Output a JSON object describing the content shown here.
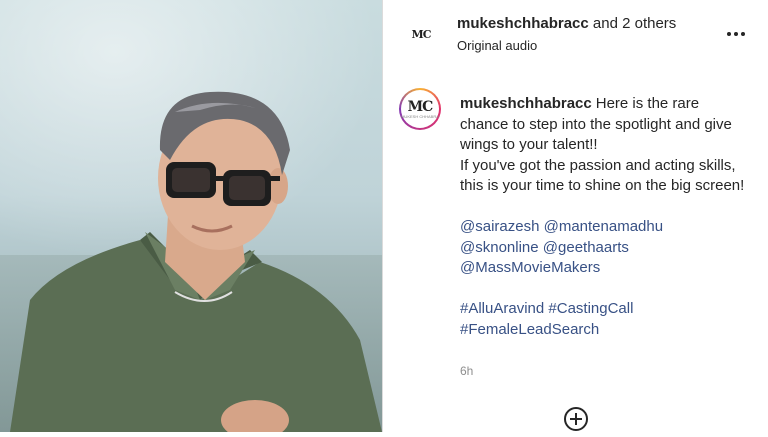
{
  "video": {
    "description_colors": {
      "sky": "#c9dcdf",
      "shirt": "#5b6e54"
    }
  },
  "header": {
    "avatar_text": "MC",
    "username": "mukeshchhabracc",
    "collab_text": "and 2 others",
    "audio_label": "Original audio"
  },
  "post": {
    "avatar_text": "MC",
    "avatar_subtext": "MUKESH CHHABRA",
    "username": "mukeshchhabracc",
    "caption_line1": "Here is the rare chance to step into the spotlight and give wings to your talent!!",
    "caption_line2": "If you've got the passion and acting skills, this is your time to shine on the big screen!",
    "mentions": [
      "@sairazesh",
      "@mantenamadhu",
      "@sknonline",
      "@geethaarts",
      "@MassMovieMakers"
    ],
    "hashtags": [
      "#AlluAravind",
      "#CastingCall",
      "#FemaleLeadSearch"
    ],
    "time": "6h"
  },
  "icons": {
    "more": "more-horizontal-icon",
    "add": "add-circle-icon"
  },
  "colors": {
    "link": "#385185",
    "text": "#262626",
    "muted": "#8e8e8e"
  }
}
